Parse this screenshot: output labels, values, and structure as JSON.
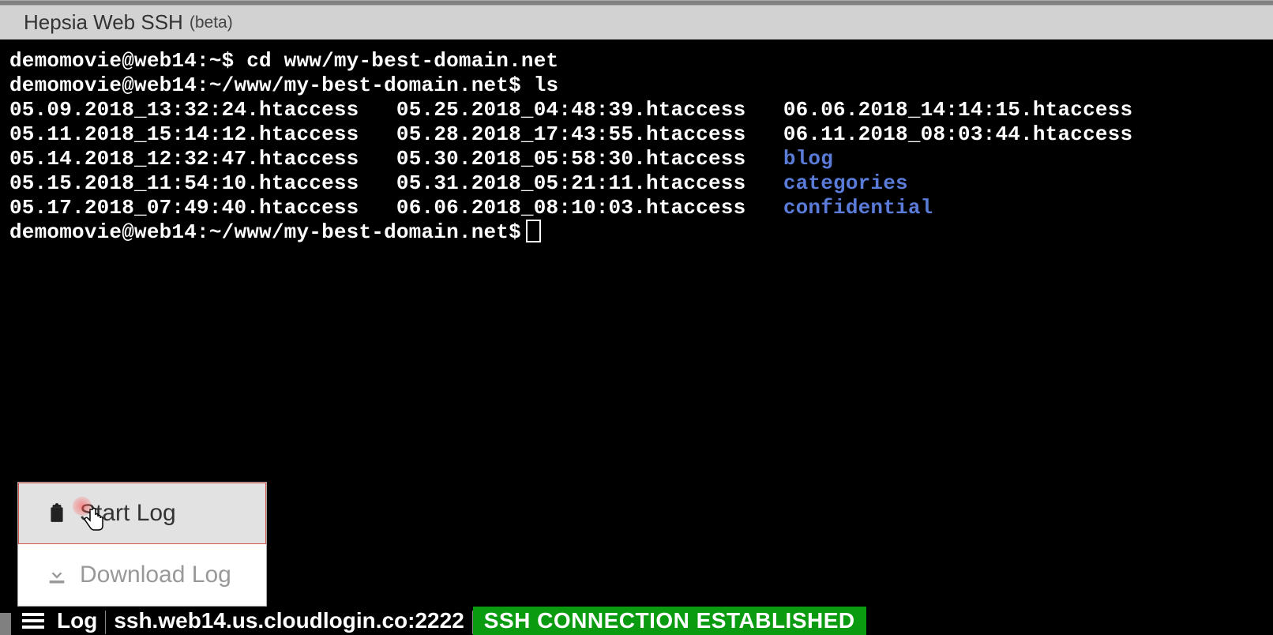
{
  "header": {
    "title": "Hepsia Web SSH",
    "suffix": "(beta)"
  },
  "terminal": {
    "line1": "demomovie@web14:~$ cd www/my-best-domain.net",
    "line2": "demomovie@web14:~/www/my-best-domain.net$ ls",
    "col1": [
      "05.09.2018_13:32:24.htaccess",
      "05.11.2018_15:14:12.htaccess",
      "05.14.2018_12:32:47.htaccess",
      "05.15.2018_11:54:10.htaccess",
      "05.17.2018_07:49:40.htaccess"
    ],
    "col2": [
      "05.25.2018_04:48:39.htaccess",
      "05.28.2018_17:43:55.htaccess",
      "05.30.2018_05:58:30.htaccess",
      "05.31.2018_05:21:11.htaccess",
      "06.06.2018_08:10:03.htaccess"
    ],
    "col3_files": [
      "06.06.2018_14:14:15.htaccess",
      "06.11.2018_08:03:44.htaccess"
    ],
    "col3_dirs": [
      "blog",
      "categories",
      "confidential"
    ],
    "prompt": "demomovie@web14:~/www/my-best-domain.net$"
  },
  "menu": {
    "start_log": "Start Log",
    "download_log": "Download Log"
  },
  "status": {
    "log_label": "Log",
    "host": "ssh.web14.us.cloudlogin.co:2222",
    "connection": "SSH CONNECTION ESTABLISHED"
  }
}
